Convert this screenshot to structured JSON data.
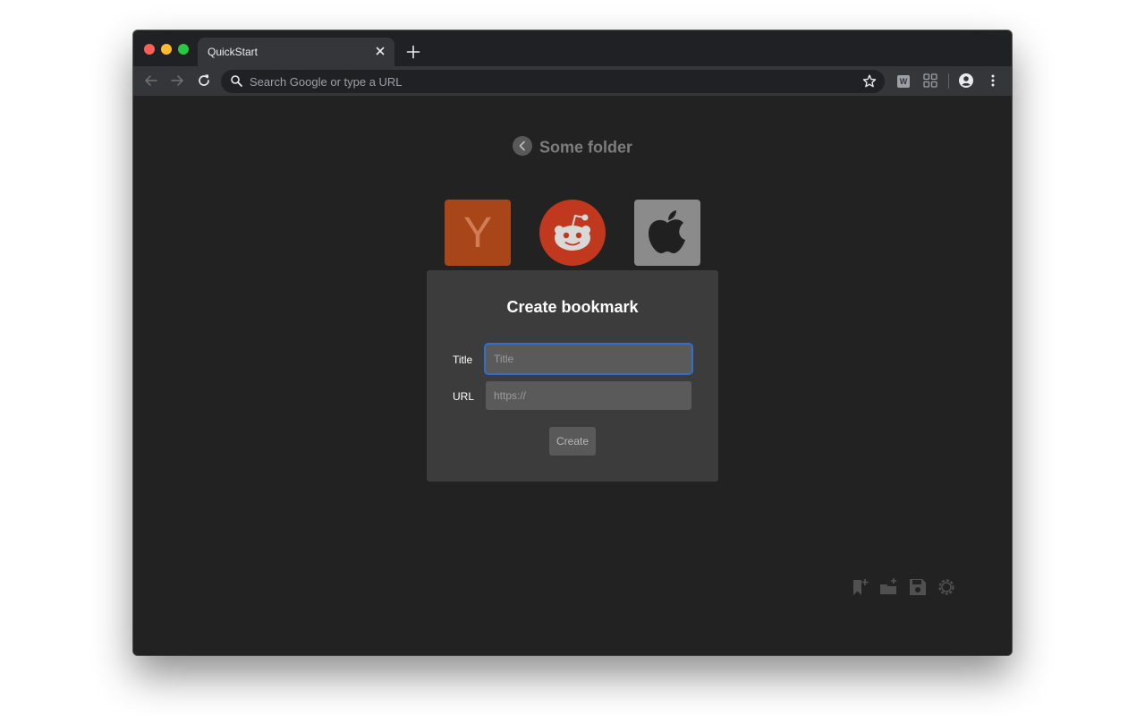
{
  "browser": {
    "tab": {
      "title": "QuickStart"
    },
    "omnibox": {
      "placeholder": "Search Google or type a URL"
    },
    "extension_badge": "W",
    "icons": [
      "close-icon",
      "plus-icon",
      "back-arrow-icon",
      "forward-arrow-icon",
      "reload-icon",
      "search-icon",
      "star-icon",
      "grid-icon",
      "profile-icon",
      "more-vertical-icon"
    ]
  },
  "page": {
    "folder_title": "Some folder",
    "tiles": [
      {
        "name": "Y Combinator",
        "glyph": "Y",
        "color": "#a8461a"
      },
      {
        "name": "Reddit",
        "icon": "reddit-icon",
        "color": "#c0381d"
      },
      {
        "name": "Apple",
        "icon": "apple-icon",
        "color": "#8b8b8b"
      }
    ],
    "actions": [
      "add-bookmark-icon",
      "add-folder-icon",
      "save-icon",
      "settings-icon"
    ]
  },
  "dialog": {
    "title": "Create bookmark",
    "fields": [
      {
        "label": "Title",
        "placeholder": "Title",
        "value": ""
      },
      {
        "label": "URL",
        "placeholder": "https://",
        "value": ""
      }
    ],
    "submit_label": "Create"
  },
  "colors": {
    "accent_focus": "#2f6fd0",
    "page_bg": "#222222",
    "dialog_bg": "#3c3c3c"
  }
}
